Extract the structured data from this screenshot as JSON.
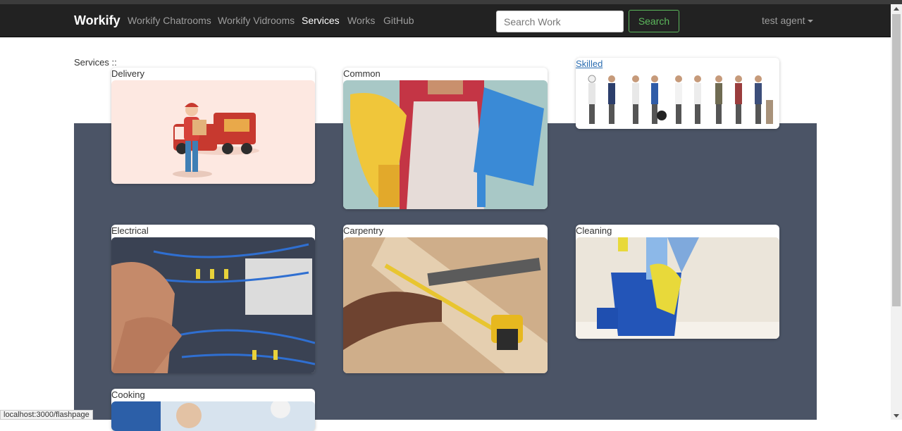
{
  "navbar": {
    "brand": "Workify",
    "links": [
      "Workify Chatrooms",
      "Workify Vidrooms",
      "Services",
      "Works",
      "GitHub"
    ],
    "active": "Services",
    "search_placeholder": "Search Work",
    "search_button": "Search",
    "user": "test agent"
  },
  "page": {
    "services_label": "Services ::"
  },
  "cards": [
    {
      "title": "Delivery"
    },
    {
      "title": "Common"
    },
    {
      "title": "Skilled"
    },
    {
      "title": "Electrical"
    },
    {
      "title": "Carpentry"
    },
    {
      "title": "Cleaning"
    },
    {
      "title": "Cooking"
    }
  ],
  "status_url": "localhost:3000/flashpage",
  "colors": {
    "navbar": "#222222",
    "panel": "#4b5466",
    "search_button": "#5cb85c",
    "link": "#2a6cb0"
  }
}
